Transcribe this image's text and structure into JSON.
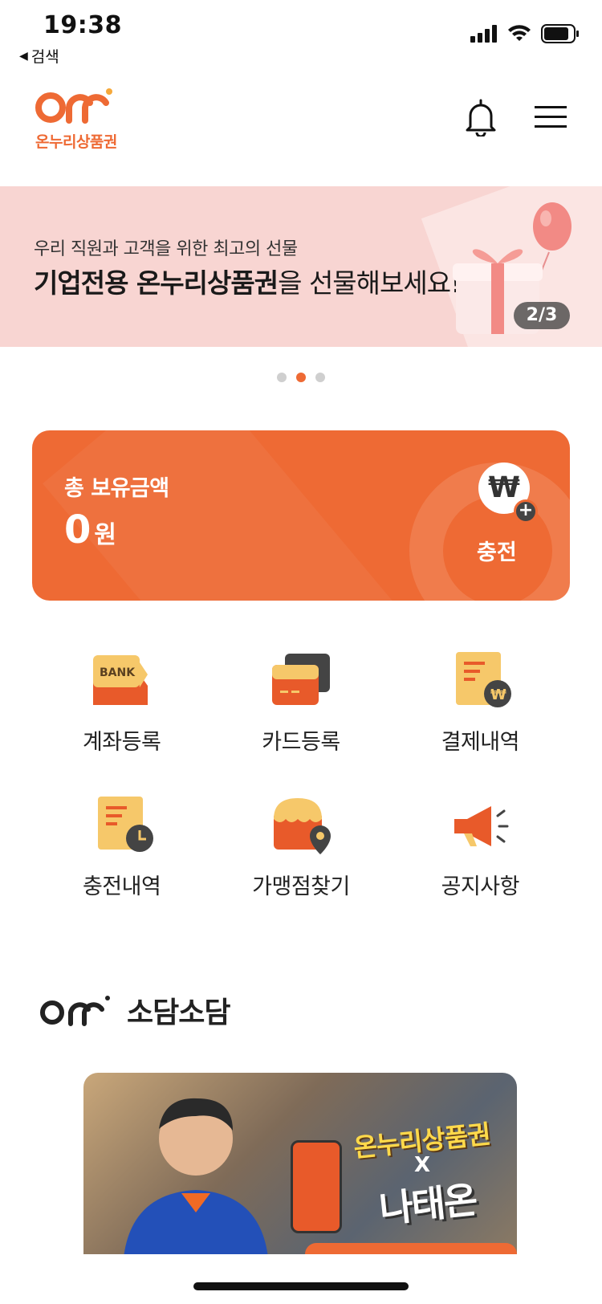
{
  "status_bar": {
    "time": "19:38",
    "back_label": "검색"
  },
  "header": {
    "logo_text": "온누리상품권"
  },
  "banner": {
    "subtitle": "우리 직원과 고객을 위한 최고의 선물",
    "title_bold": "기업전용 온누리상품권",
    "title_rest": "을 선물해보세요!",
    "counter": "2/3",
    "page_count": 3,
    "active_page": 2
  },
  "balance": {
    "label": "총 보유금액",
    "amount": "0",
    "unit": "원",
    "charge_symbol": "₩",
    "charge_label": "충전"
  },
  "menu": [
    {
      "id": "account",
      "label": "계좌등록",
      "icon": "bank-icon",
      "bank_text": "BANK"
    },
    {
      "id": "card",
      "label": "카드등록",
      "icon": "card-icon"
    },
    {
      "id": "payments",
      "label": "결제내역",
      "icon": "receipt-won-icon"
    },
    {
      "id": "charges",
      "label": "충전내역",
      "icon": "receipt-clock-icon"
    },
    {
      "id": "stores",
      "label": "가맹점찾기",
      "icon": "store-location-icon"
    },
    {
      "id": "notices",
      "label": "공지사항",
      "icon": "megaphone-icon"
    }
  ],
  "sodam": {
    "title": "소담소담",
    "card_title": "온누리상품권",
    "card_x": "X",
    "card_subtitle": "나태온"
  },
  "colors": {
    "brand": "#ee6a34",
    "banner_bg": "#f8d5d2",
    "icon_yellow": "#f6c86a",
    "icon_dark": "#444444"
  }
}
